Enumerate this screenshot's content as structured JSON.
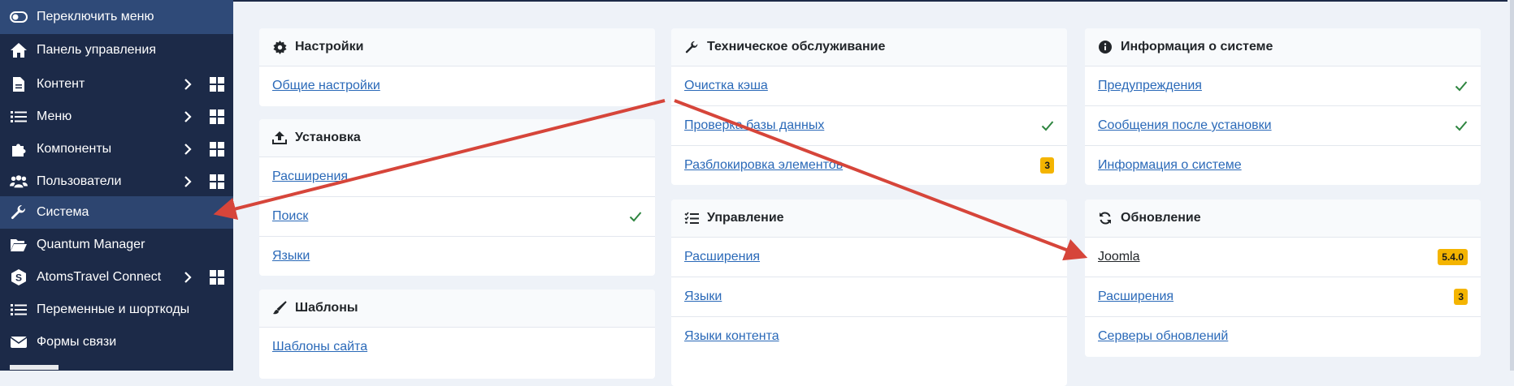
{
  "sidebar": {
    "toggle_label": "Переключить меню",
    "items": [
      {
        "label": "Панель управления",
        "icon": "home-icon"
      },
      {
        "label": "Контент",
        "icon": "file-icon"
      },
      {
        "label": "Меню",
        "icon": "list-icon"
      },
      {
        "label": "Компоненты",
        "icon": "puzzle-icon"
      },
      {
        "label": "Пользователи",
        "icon": "users-icon"
      },
      {
        "label": "Система",
        "icon": "wrench-icon"
      },
      {
        "label": "Quantum Manager",
        "icon": "folder-icon"
      },
      {
        "label": "AtomsTravel Connect",
        "icon": "s-logo-icon"
      },
      {
        "label": "Переменные и шорткоды",
        "icon": "list-icon"
      },
      {
        "label": "Формы связи",
        "icon": "envelope-icon"
      }
    ]
  },
  "cards": {
    "settings": {
      "title": "Настройки",
      "rows": [
        "Общие настройки"
      ]
    },
    "install": {
      "title": "Установка",
      "rows": [
        "Расширения",
        "Поиск",
        "Языки"
      ]
    },
    "templates": {
      "title": "Шаблоны",
      "rows": [
        "Шаблоны сайта"
      ]
    },
    "maintenance": {
      "title": "Техническое обслуживание",
      "rows": [
        "Очистка кэша",
        "Проверка базы данных",
        "Разблокировка элементов"
      ],
      "badge": "3"
    },
    "manage": {
      "title": "Управление",
      "rows": [
        "Расширения",
        "Языки",
        "Языки контента"
      ]
    },
    "sysinfo": {
      "title": "Информация о системе",
      "rows": [
        "Предупреждения",
        "Сообщения после установки",
        "Информация о системе"
      ]
    },
    "update": {
      "title": "Обновление",
      "rows": [
        "Joomla",
        "Расширения",
        "Серверы обновлений"
      ],
      "badges": [
        "5.4.0",
        "3"
      ]
    }
  },
  "colors": {
    "sidebar": "#1c2a48",
    "link": "#2a69b8",
    "badge": "#f4b400",
    "check": "#2e8540",
    "arrow": "#d6453a"
  }
}
